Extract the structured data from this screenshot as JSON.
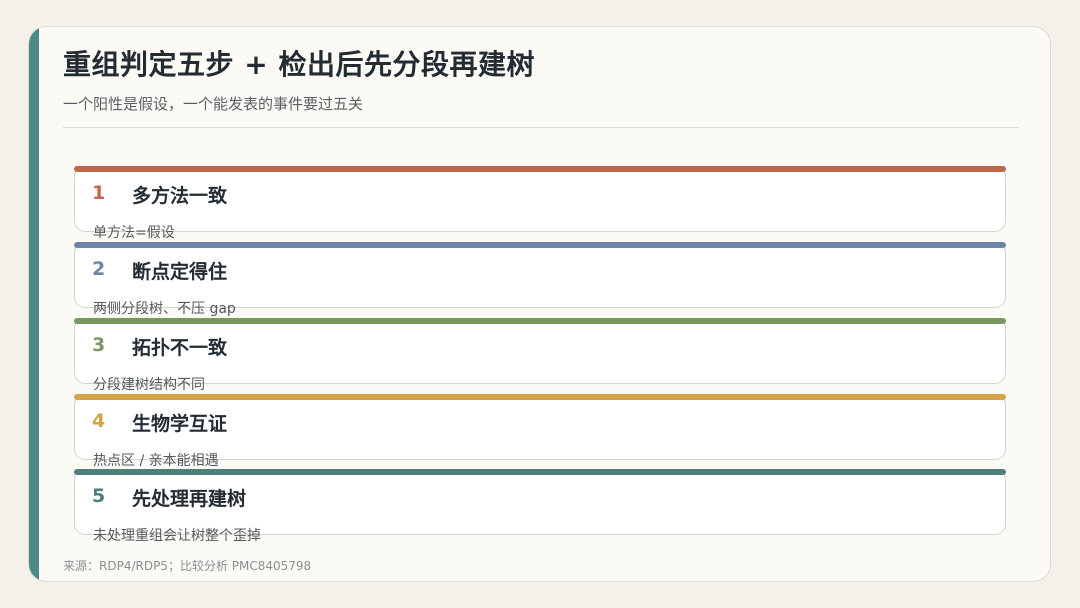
{
  "colors": {
    "page_background": "#f3f1ea",
    "card_background": "#fbfaf5",
    "accent_bar": "#4e8a87",
    "title_text": "#232b33"
  },
  "header": {
    "title": "重组判定五步 + 检出后先分段再建树",
    "subtitle": "一个阳性是假设，一个能发表的事件要过五关"
  },
  "steps": [
    {
      "number": "1",
      "title": "多方法一致",
      "description": "单方法=假设",
      "color": "#c0674a"
    },
    {
      "number": "2",
      "title": "断点定得住",
      "description": "两侧分段树、不压 gap",
      "color": "#6e86a8"
    },
    {
      "number": "3",
      "title": "拓扑不一致",
      "description": "分段建树结构不同",
      "color": "#77985f"
    },
    {
      "number": "4",
      "title": "生物学互证",
      "description": "热点区 / 亲本能相遇",
      "color": "#d2a447"
    },
    {
      "number": "5",
      "title": "先处理再建树",
      "description": "未处理重组会让树整个歪掉",
      "color": "#4e7f7d"
    }
  ],
  "footer": {
    "source": "来源：RDP4/RDP5；比较分析 PMC8405798"
  }
}
